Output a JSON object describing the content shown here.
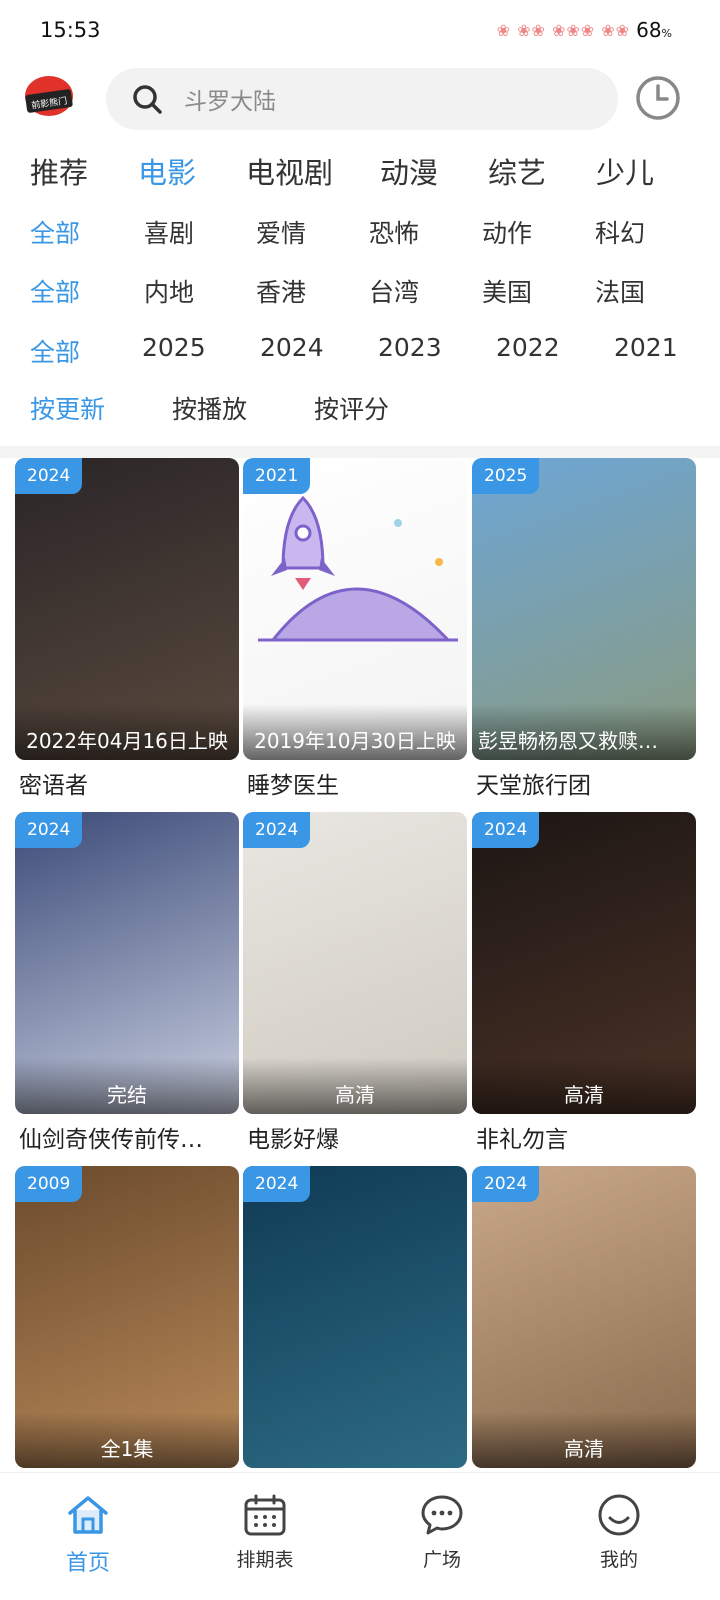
{
  "status_bar": {
    "time": "15:53",
    "battery": "68",
    "battery_unit": "%"
  },
  "header": {
    "logo_text": "前影熊门",
    "search_placeholder": "斗罗大陆"
  },
  "category_tabs": [
    {
      "label": "推荐",
      "active": false
    },
    {
      "label": "电影",
      "active": true
    },
    {
      "label": "电视剧",
      "active": false
    },
    {
      "label": "动漫",
      "active": false
    },
    {
      "label": "综艺",
      "active": false
    },
    {
      "label": "少儿",
      "active": false
    }
  ],
  "filters": {
    "genre": [
      "全部",
      "喜剧",
      "爱情",
      "恐怖",
      "动作",
      "科幻"
    ],
    "region": [
      "全部",
      "内地",
      "香港",
      "台湾",
      "美国",
      "法国"
    ],
    "year": [
      "全部",
      "2025",
      "2024",
      "2023",
      "2022",
      "2021"
    ],
    "sort": [
      "按更新",
      "按播放",
      "按评分"
    ]
  },
  "movies": [
    {
      "year": "2024",
      "caption": "2022年04月16日上映",
      "title": "密语者",
      "colors": [
        "#2a2527",
        "#5a4a3e"
      ]
    },
    {
      "year": "2021",
      "caption": "2019年10月30日上映",
      "title": "睡梦医生",
      "colors": [
        "#ffffff",
        "#f3f3f3"
      ]
    },
    {
      "year": "2025",
      "caption": "彭昱畅杨恩又救赎…",
      "title": "天堂旅行团",
      "colors": [
        "#6da6d6",
        "#8a9a7e"
      ]
    },
    {
      "year": "2024",
      "caption": "完结",
      "title": "仙剑奇侠传前传…",
      "colors": [
        "#3b4a78",
        "#c9cfe0"
      ]
    },
    {
      "year": "2024",
      "caption": "高清",
      "title": "电影好爆",
      "colors": [
        "#e9e7e2",
        "#cfcac0"
      ]
    },
    {
      "year": "2024",
      "caption": "高清",
      "title": "非礼勿言",
      "colors": [
        "#1c1614",
        "#4a3226"
      ]
    },
    {
      "year": "2009",
      "caption": "全1集",
      "title": "",
      "colors": [
        "#6b4a2c",
        "#b98a5a"
      ]
    },
    {
      "year": "2024",
      "caption": "",
      "title": "",
      "colors": [
        "#0f3a55",
        "#2d6b83"
      ]
    },
    {
      "year": "2024",
      "caption": "高清",
      "title": "",
      "colors": [
        "#c9a98a",
        "#8a6a4c"
      ]
    }
  ],
  "bottom_nav": [
    {
      "label": "首页",
      "icon": "home-icon",
      "active": true
    },
    {
      "label": "排期表",
      "icon": "calendar-icon",
      "active": false
    },
    {
      "label": "广场",
      "icon": "chat-bubble-icon",
      "active": false
    },
    {
      "label": "我的",
      "icon": "profile-smile-icon",
      "active": false
    }
  ],
  "theme": {
    "accent": "#3a97e6"
  }
}
